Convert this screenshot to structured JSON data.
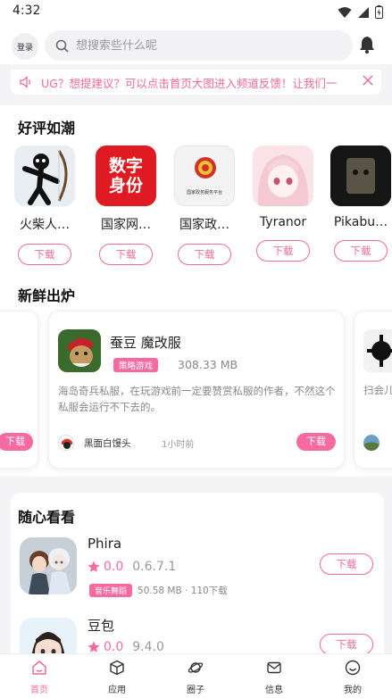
{
  "status_bar": {
    "time": "4:32"
  },
  "header": {
    "login_label": "登录",
    "search_placeholder": "想搜索些什么呢"
  },
  "notice": {
    "text": "UG？想提建议？可以点击首页大图进入频道反馈！让我们一"
  },
  "section_top": {
    "title": "好评如潮",
    "download_label": "下载",
    "apps": [
      {
        "name": "火柴人…"
      },
      {
        "name": "国家网…",
        "icon_text": "数字身份"
      },
      {
        "name": "国家政…",
        "icon_text": "国家政务服务平台"
      },
      {
        "name": "Tyranor"
      },
      {
        "name": "Pikabu…"
      }
    ]
  },
  "section_fresh": {
    "title": "新鲜出炉",
    "download_label": "下载",
    "featured": {
      "title": "蚕豆 魔改服",
      "tag": "策略游戏",
      "size": "308.33 MB",
      "description": "海岛奇兵私服，在玩游戏前一定要赞赏私服的作者，不然这个私服会运行不下去的。",
      "author": "黑面白馒头",
      "time": "1小时前"
    },
    "next_card": {
      "desc_fragment": "扫会儿"
    }
  },
  "section_random": {
    "title": "随心看看",
    "download_label": "下载",
    "items": [
      {
        "name": "Phira",
        "score": "0.0",
        "version": "0.6.7.1",
        "tag": "音乐舞蹈",
        "size_info": "50.58 MB · 110下载"
      },
      {
        "name": "豆包",
        "score": "0.0",
        "version": "9.4.0"
      }
    ]
  },
  "bottom_nav": [
    {
      "label": "首页",
      "icon": "home-icon",
      "active": true
    },
    {
      "label": "应用",
      "icon": "cube-icon",
      "active": false
    },
    {
      "label": "圈子",
      "icon": "planet-icon",
      "active": false
    },
    {
      "label": "信息",
      "icon": "mail-icon",
      "active": false
    },
    {
      "label": "我的",
      "icon": "smile-icon",
      "active": false
    }
  ],
  "colors": {
    "accent": "#f06a9a",
    "tag_bg": "#f56aa0"
  }
}
